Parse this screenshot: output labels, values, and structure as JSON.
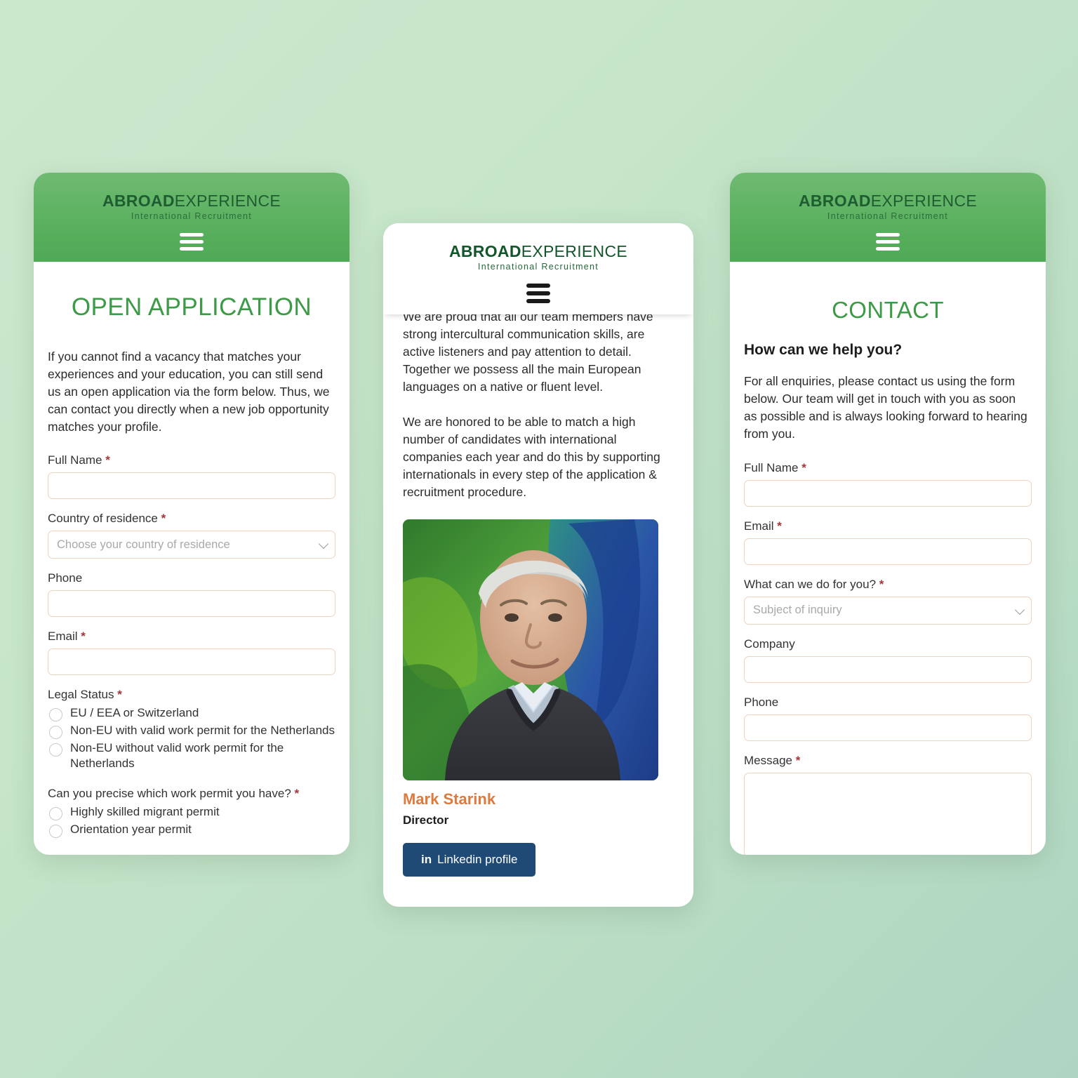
{
  "brand": {
    "logo_bold": "ABROAD",
    "logo_light": "EXPERIENCE",
    "tagline": "International Recruitment",
    "accent_green": "#3d9a46",
    "header_green": "#5bb15f",
    "accent_orange": "#dd7a3d",
    "linkedin_blue": "#1e4a75",
    "input_border": "#f0d2bd",
    "required_red": "#a6353a",
    "page_background": "#c6e5c9"
  },
  "menu": {
    "icon": "hamburger-menu-icon"
  },
  "screen_open_application": {
    "title": "OPEN APPLICATION",
    "intro": "If you cannot find a vacancy that matches your experiences and your education, you can still send us an open application via the form below. Thus, we can contact you directly when a new job opportunity matches your profile.",
    "fields": {
      "full_name": {
        "label": "Full Name",
        "required": true,
        "value": "",
        "placeholder": ""
      },
      "country": {
        "label": "Country of residence",
        "required": true,
        "placeholder": "Choose your country of residence",
        "value": ""
      },
      "phone": {
        "label": "Phone",
        "required": false,
        "value": "",
        "placeholder": ""
      },
      "email": {
        "label": "Email",
        "required": true,
        "value": "",
        "placeholder": ""
      }
    },
    "legal_status": {
      "question": "Legal Status",
      "required": true,
      "options": [
        "EU / EEA or Switzerland",
        "Non-EU with valid work permit for the Netherlands",
        "Non-EU without valid work permit for the Netherlands"
      ]
    },
    "work_permit": {
      "question": "Can you precise which work permit you have?",
      "required": true,
      "options": [
        "Highly skilled migrant permit",
        "Orientation year permit"
      ]
    }
  },
  "screen_team": {
    "paragraph_1": "We are proud that all our team members have strong intercultural communication skills, are active listeners and pay attention to detail. Together we possess all the main European languages on a native or fluent level.",
    "paragraph_2": "We are honored to be able to match a high number of candidates with international companies each year and do this by supporting internationals in every step of the application & recruitment procedure.",
    "person": {
      "photo_alt": "Portrait of Mark Starink in front of a green and blue painting",
      "name": "Mark Starink",
      "role": "Director",
      "linkedin_label": "Linkedin profile",
      "linkedin_glyph": "in"
    }
  },
  "screen_contact": {
    "title": "CONTACT",
    "heading": "How can we help you?",
    "intro": "For all enquiries, please contact us using the form below. Our team will get in touch with you as soon as possible and is always looking forward to hearing from you.",
    "fields": {
      "full_name": {
        "label": "Full Name",
        "required": true,
        "value": "",
        "placeholder": ""
      },
      "email": {
        "label": "Email",
        "required": true,
        "value": "",
        "placeholder": ""
      },
      "subject": {
        "label": "What can we do for you?",
        "required": true,
        "placeholder": "Subject of inquiry",
        "value": ""
      },
      "company": {
        "label": "Company",
        "required": false,
        "value": "",
        "placeholder": ""
      },
      "phone": {
        "label": "Phone",
        "required": false,
        "value": "",
        "placeholder": ""
      },
      "message": {
        "label": "Message",
        "required": true,
        "value": "",
        "placeholder": ""
      }
    }
  }
}
